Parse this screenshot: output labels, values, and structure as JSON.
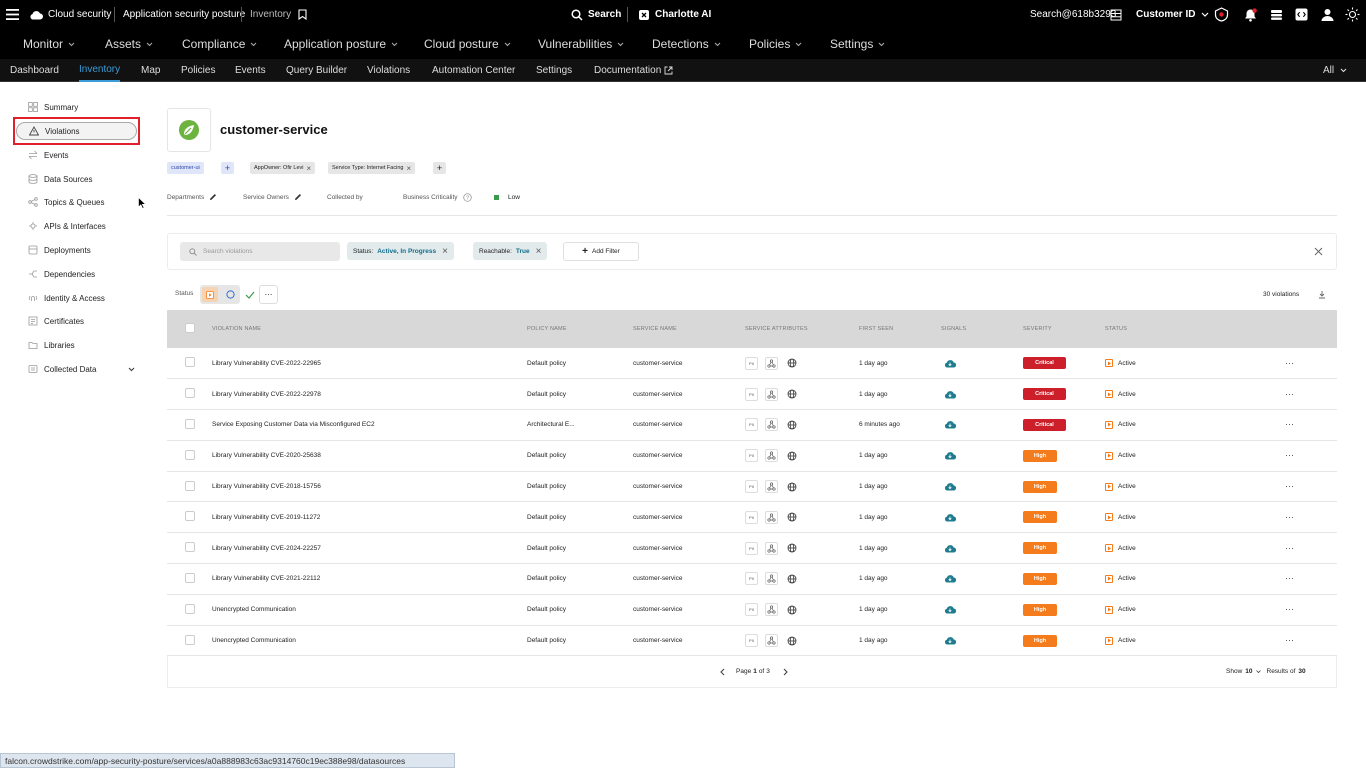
{
  "topbar": {
    "brand": "Cloud security",
    "breadcrumb_section": "Application security posture",
    "breadcrumb_page": "Inventory",
    "search_label": "Search",
    "ai_label": "Charlotte AI",
    "user": "Search@618b3293",
    "customer_id": "Customer ID"
  },
  "nav": {
    "items": [
      "Monitor",
      "Assets",
      "Compliance",
      "Application posture",
      "Cloud posture",
      "Vulnerabilities",
      "Detections",
      "Policies",
      "Settings"
    ]
  },
  "subnav": {
    "items": [
      "Dashboard",
      "Inventory",
      "Map",
      "Policies",
      "Events",
      "Query Builder",
      "Violations",
      "Automation Center",
      "Settings",
      "Documentation"
    ],
    "active": "Inventory",
    "scope": "All"
  },
  "sidebar": {
    "items": [
      "Summary",
      "Violations",
      "Events",
      "Data Sources",
      "Topics & Queues",
      "APIs & Interfaces",
      "Deployments",
      "Dependencies",
      "Identity & Access",
      "Certificates",
      "Libraries",
      "Collected Data"
    ],
    "selected": "Violations"
  },
  "service": {
    "name": "customer-service",
    "tags": [
      "customer-ui",
      "AppOwner: Ofir Levi",
      "Service Type: Internet Facing"
    ],
    "meta": {
      "departments": "Departments",
      "service_owners": "Service Owners",
      "collected_by": "Collected by",
      "business_criticality": "Business Criticality",
      "criticality_value": "Low"
    },
    "colors": {
      "low": "#3a9b4b",
      "critical": "#cc1f2a",
      "high": "#f47c1c",
      "accent": "#3b9bd6"
    }
  },
  "filters": {
    "search_placeholder": "Search violations",
    "status_label": "Status:",
    "status_value": "Active, In Progress",
    "reachable_label": "Reachable:",
    "reachable_value": "True",
    "add_filter": "Add Filter"
  },
  "toolbar": {
    "status_label": "Status",
    "count": "30 violations"
  },
  "table": {
    "columns": [
      "VIOLATION NAME",
      "POLICY NAME",
      "SERVICE NAME",
      "SERVICE ATTRIBUTES",
      "FIRST SEEN",
      "SIGNALS",
      "SEVERITY",
      "STATUS"
    ],
    "attr_pii": "PII",
    "rows": [
      {
        "name": "Library Vulnerability CVE-2022-22965",
        "policy": "Default policy",
        "service": "customer-service",
        "first_seen": "1 day ago",
        "severity": "Critical",
        "status": "Active"
      },
      {
        "name": "Library Vulnerability CVE-2022-22978",
        "policy": "Default policy",
        "service": "customer-service",
        "first_seen": "1 day ago",
        "severity": "Critical",
        "status": "Active"
      },
      {
        "name": "Service Exposing Customer Data via Misconfigured EC2",
        "policy": "Architectural E...",
        "service": "customer-service",
        "first_seen": "6 minutes ago",
        "severity": "Critical",
        "status": "Active"
      },
      {
        "name": "Library Vulnerability CVE-2020-25638",
        "policy": "Default policy",
        "service": "customer-service",
        "first_seen": "1 day ago",
        "severity": "High",
        "status": "Active"
      },
      {
        "name": "Library Vulnerability CVE-2018-15756",
        "policy": "Default policy",
        "service": "customer-service",
        "first_seen": "1 day ago",
        "severity": "High",
        "status": "Active"
      },
      {
        "name": "Library Vulnerability CVE-2019-11272",
        "policy": "Default policy",
        "service": "customer-service",
        "first_seen": "1 day ago",
        "severity": "High",
        "status": "Active"
      },
      {
        "name": "Library Vulnerability CVE-2024-22257",
        "policy": "Default policy",
        "service": "customer-service",
        "first_seen": "1 day ago",
        "severity": "High",
        "status": "Active"
      },
      {
        "name": "Library Vulnerability CVE-2021-22112",
        "policy": "Default policy",
        "service": "customer-service",
        "first_seen": "1 day ago",
        "severity": "High",
        "status": "Active"
      },
      {
        "name": "Unencrypted Communication",
        "policy": "Default policy",
        "service": "customer-service",
        "first_seen": "1 day ago",
        "severity": "High",
        "status": "Active"
      },
      {
        "name": "Unencrypted Communication",
        "policy": "Default policy",
        "service": "customer-service",
        "first_seen": "1 day ago",
        "severity": "High",
        "status": "Active"
      }
    ]
  },
  "pagination": {
    "page_label": "Page",
    "current": "1",
    "of_label": "of",
    "total_pages": "3",
    "show_label": "Show",
    "page_size": "10",
    "results_label": "Results of",
    "total": "30"
  },
  "status_url": "falcon.crowdstrike.com/app-security-posture/services/a0a888983c63ac9314760c19ec388e98/datasources"
}
